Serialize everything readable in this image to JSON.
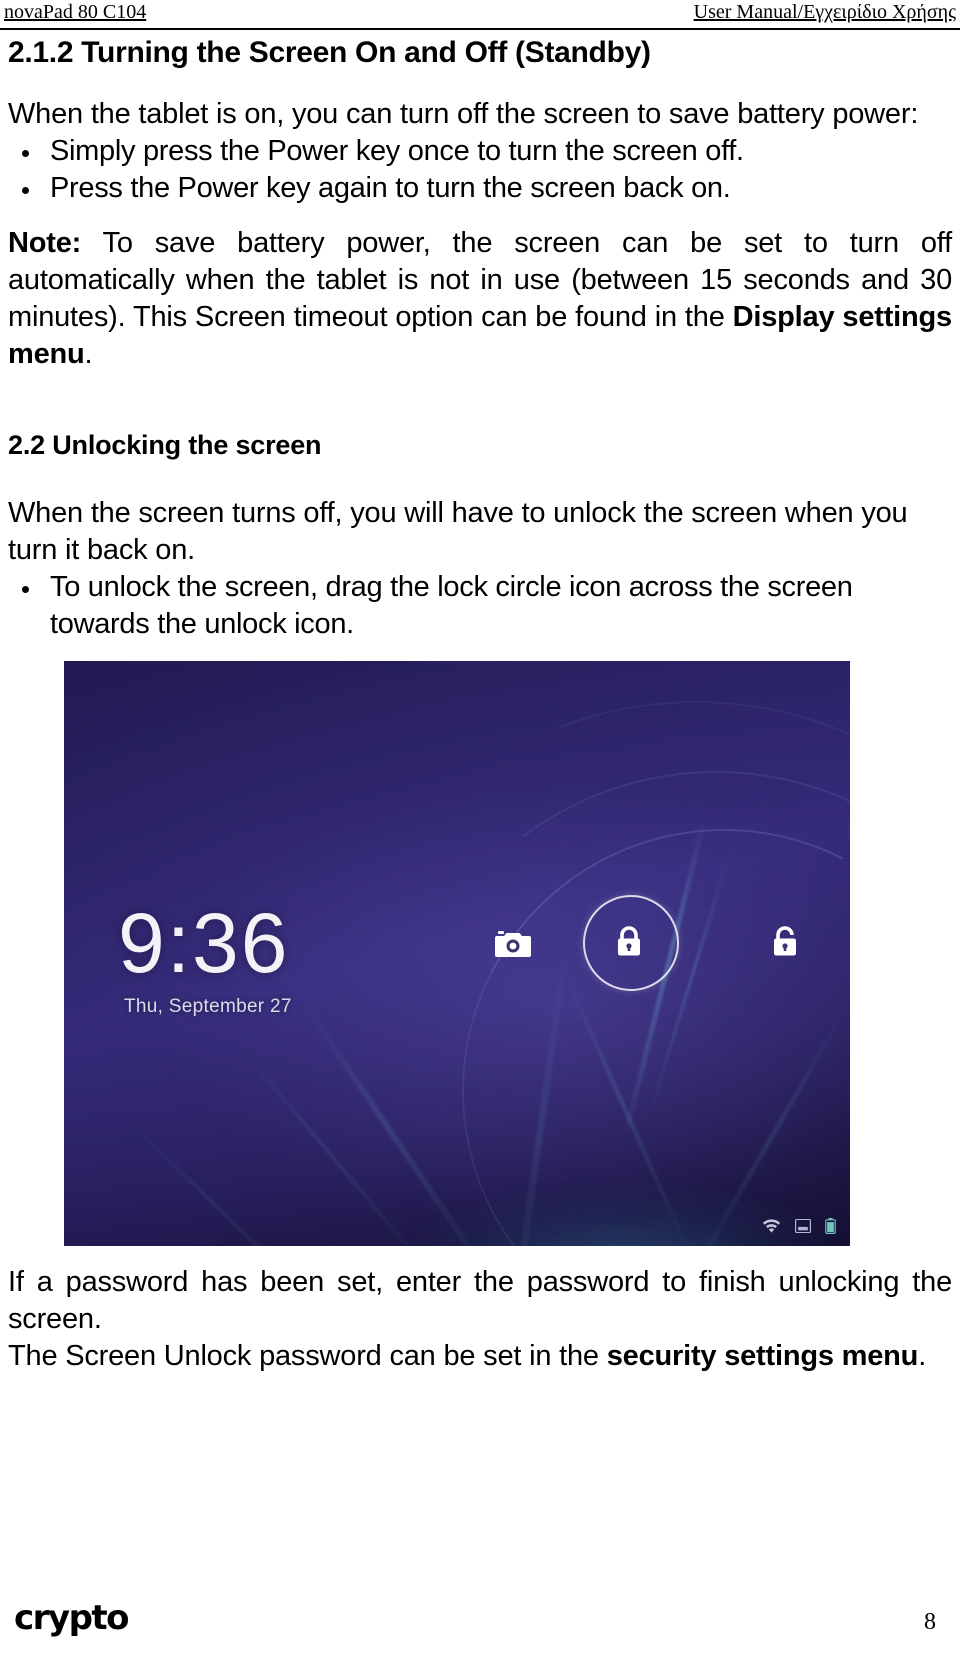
{
  "header": {
    "left": "novaPad 80 C104",
    "right": "User Manual/Εγχειρίδιο Χρήσης"
  },
  "sections": {
    "s212": {
      "heading": "2.1.2 Turning the Screen On and Off (Standby)",
      "intro": "When the tablet is on, you can turn off the screen to save battery power:",
      "bullets": [
        "Simply press the Power key once to turn the screen off.",
        "Press the Power key again to turn the screen back on."
      ],
      "note_label": "Note:",
      "note_text_1": " To save battery power, the screen can be set to turn off automatically when the tablet is not in use (between 15 seconds and 30 minutes). This Screen timeout option can be found in the ",
      "note_bold": "Display settings menu",
      "note_text_2": "."
    },
    "s22": {
      "heading": "2.2 Unlocking the screen",
      "intro": "When the screen turns off, you will have to unlock the screen when you turn it back on.",
      "bullets": [
        "To unlock the screen, drag the lock circle icon across the screen towards the unlock icon."
      ],
      "after_1": "If a password has been set, enter the password to finish unlocking the screen.",
      "after_2_text": "The Screen Unlock password can be set in the ",
      "after_2_bold": "security settings menu",
      "after_2_tail": "."
    }
  },
  "figure": {
    "name": "android-lock-screen-screenshot",
    "clock": "9:36",
    "date": "Thu, September 27",
    "icons": {
      "camera": "camera-icon",
      "lock": "lock-closed-icon",
      "unlock": "lock-open-icon",
      "status": [
        "wifi-icon",
        "signal-icon",
        "battery-icon"
      ]
    },
    "colors": {
      "background_top": "#211a52",
      "background_mid": "#332a78",
      "background_bottom": "#0d0a26",
      "accent_streak": "#78cde6",
      "foreground": "#f2f2f7"
    }
  },
  "footer": {
    "brand": "crypto",
    "page": "8"
  }
}
